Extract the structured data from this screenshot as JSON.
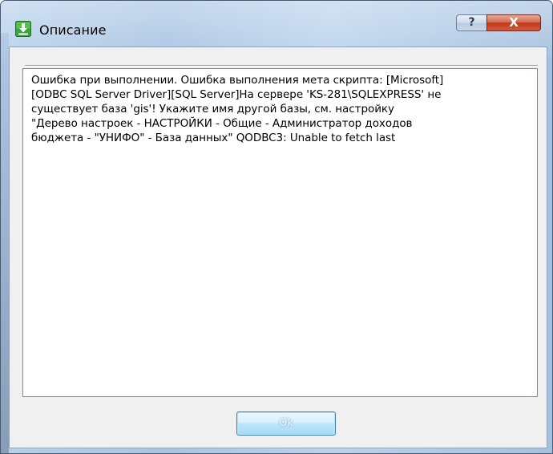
{
  "window": {
    "title": "Описание"
  },
  "titlebar": {
    "help_label": "?",
    "close_label": "X"
  },
  "message": {
    "text": "Ошибка при выполнении. Ошибка выполнения мета скрипта: [Microsoft]\n[ODBC SQL Server Driver][SQL Server]На сервере 'KS-281\\SQLEXPRESS' не\nсуществует база 'gis'! Укажите имя другой базы, см. настройку\n\"Дерево настроек - НАСТРОЙКИ - Общие - Администратор доходов\nбюджета - \"УНИФО\" - База данных\" QODBC3: Unable to fetch last"
  },
  "buttons": {
    "ok_label": "Ok"
  },
  "icons": {
    "title_icon": "download-arrow-icon",
    "help_icon": "question-icon",
    "close_icon": "close-icon"
  },
  "colors": {
    "title_icon_green": "#3aa63a",
    "close_red": "#c0391f",
    "ok_blue": "#3c7fb1"
  }
}
